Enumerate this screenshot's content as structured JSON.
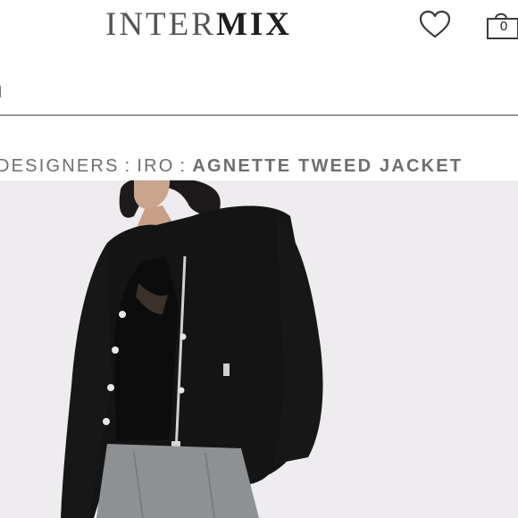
{
  "header": {
    "logo_light": "INTER",
    "logo_bold": "MIX",
    "wishlist_icon": "heart-icon",
    "bag_icon": "shopping-bag-icon",
    "bag_count": "0"
  },
  "search": {
    "text": "h"
  },
  "breadcrumb": {
    "items": [
      "DESIGNERS",
      "IRO"
    ],
    "separator": ":",
    "current": "AGNETTE TWEED JACKET"
  },
  "product": {
    "image_icon": "product-photo",
    "background": "#eeecef",
    "jacket_color": "#141414"
  }
}
